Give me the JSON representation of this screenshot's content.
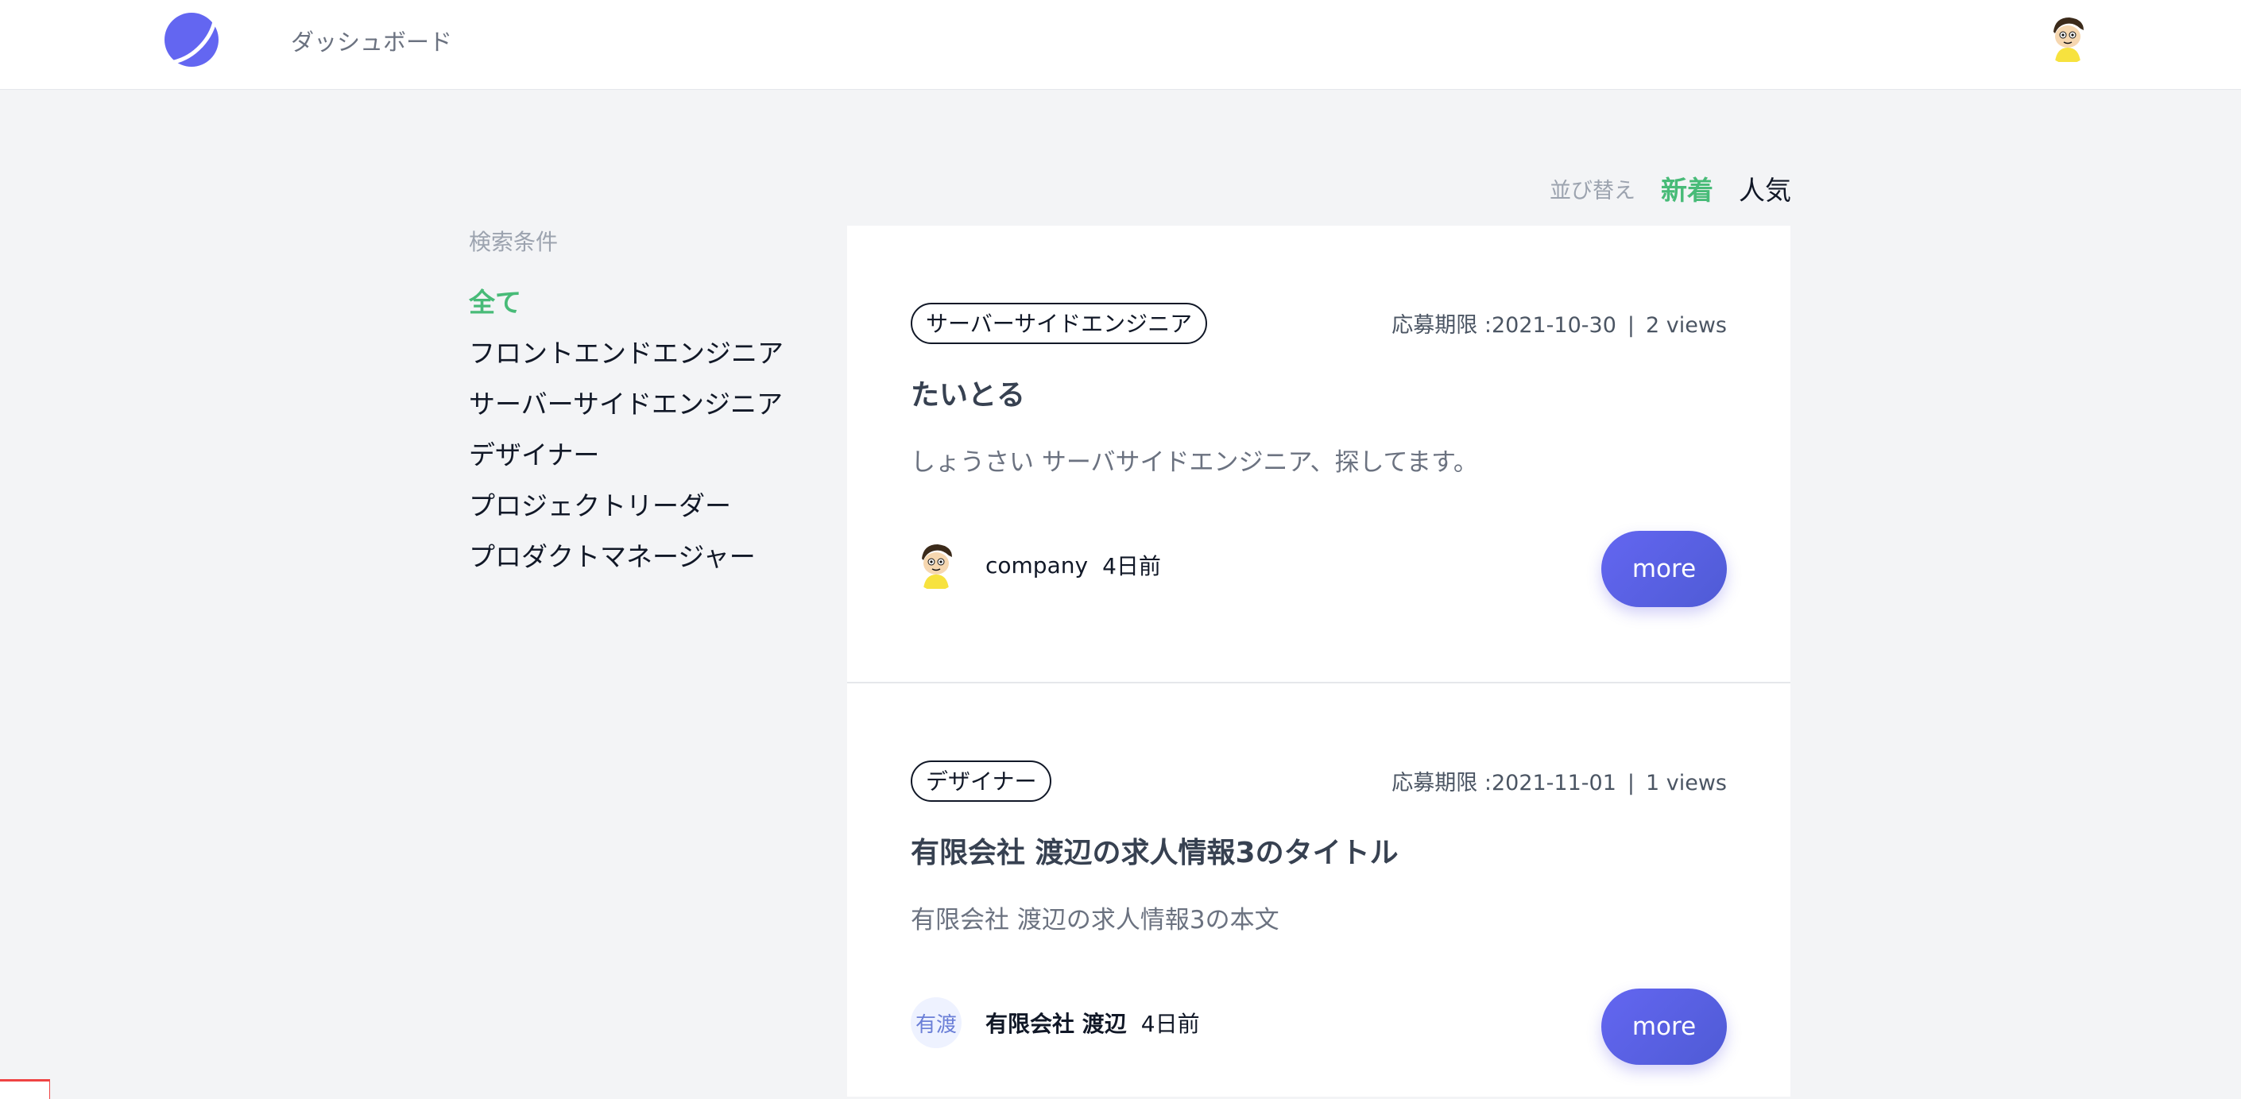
{
  "nav": {
    "logo_icon": "app-logo-icon",
    "link_label": "ダッシュボード",
    "user_avatar_icon": "user-avatar-icon"
  },
  "sort": {
    "label": "並び替え",
    "options": [
      "新着",
      "人気"
    ],
    "active_index": 0
  },
  "sidebar": {
    "title": "検索条件",
    "items": [
      "全て",
      "フロントエンドエンジニア",
      "サーバーサイドエンジニア",
      "デザイナー",
      "プロジェクトリーダー",
      "プロダクトマネージャー"
    ],
    "active_index": 0
  },
  "posts": [
    {
      "tag": "サーバーサイドエンジニア",
      "deadline": "応募期限 :2021-10-30",
      "sep": "|",
      "views": "2 views",
      "title": "たいとる",
      "description": "しょうさい サーバサイドエンジニア、探してます。",
      "author": "company",
      "time": "4日前",
      "avatar_type": "image",
      "more_label": "more"
    },
    {
      "tag": "デザイナー",
      "deadline": "応募期限 :2021-11-01",
      "sep": "|",
      "views": "1 views",
      "title": "有限会社 渡辺の求人情報3のタイトル",
      "description": "有限会社 渡辺の求人情報3の本文",
      "author": "有限会社 渡辺",
      "time": "4日前",
      "avatar_type": "initials",
      "avatar_initials": "有渡",
      "more_label": "more"
    }
  ],
  "colors": {
    "accent_green": "#48bb78",
    "button_indigo": "#5a5fe0",
    "page_bg": "#f3f4f6"
  }
}
